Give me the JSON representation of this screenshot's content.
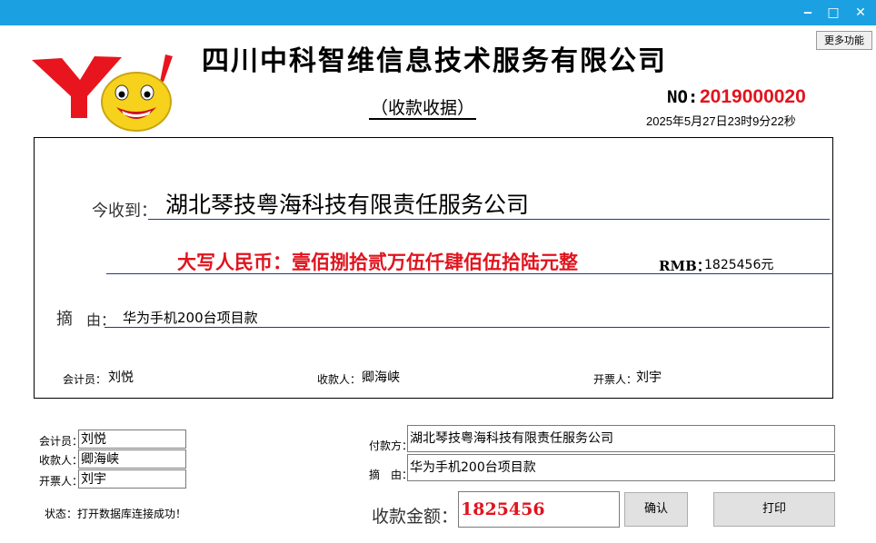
{
  "window": {
    "minimize_icon": "minimize-icon",
    "maximize_icon": "maximize-icon",
    "close_icon": "close-icon",
    "minimize_glyph": "‒",
    "maximize_glyph": "□",
    "close_glyph": "✕"
  },
  "toolbar": {
    "more_functions_label": "更多功能"
  },
  "header": {
    "logo_icon": "yahoo-smiley-logo",
    "company_name": "四川中科智维信息技术服务有限公司",
    "receipt_title": "（收款收据）",
    "number_label": "NO:",
    "number_value": "2019000020",
    "timestamp": "2025年5月27日23时9分22秒"
  },
  "receipt": {
    "received_from_label": "今收到：",
    "received_from_value": "湖北琴技粤海科技有限责任服务公司",
    "amount_words": "大写人民币：壹佰捌拾贰万伍仟肆佰伍拾陆元整",
    "rmb_label": "RMB：",
    "rmb_value": "1825456元",
    "memo_label_1": "摘",
    "memo_label_2": "由：",
    "memo_value": "华为手机200台项目款",
    "accountant_label": "会计员：",
    "accountant_value": "刘悦",
    "receiver_label": "收款人：",
    "receiver_value": "卿海峡",
    "issuer_label": "开票人：",
    "issuer_value": "刘宇"
  },
  "form": {
    "accountant_label": "会计员：",
    "accountant_value": "刘悦",
    "receiver_label": "收款人：",
    "receiver_value": "卿海峡",
    "issuer_label": "开票人：",
    "issuer_value": "刘宇",
    "status_text": "状态：打开数据库连接成功！",
    "payer_label": "付款方：",
    "payer_value": "湖北琴技粤海科技有限责任服务公司",
    "memo_label": "摘　由：",
    "memo_value": "华为手机200台项目款",
    "amount_label": "收款金额：",
    "amount_value": "1825456",
    "confirm_label": "确认",
    "print_label": "打印"
  },
  "colors": {
    "titlebar": "#1ba1e2",
    "accent_red": "#e0141e",
    "line_blue": "#1f3a8a"
  }
}
